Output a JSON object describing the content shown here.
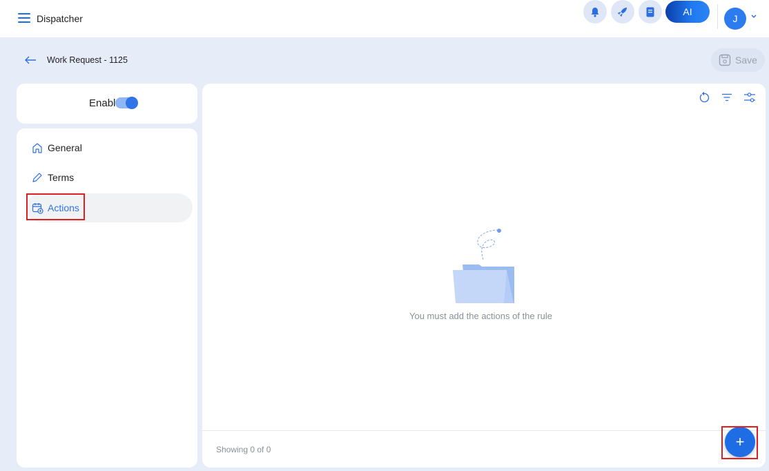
{
  "app": {
    "title": "Dispatcher"
  },
  "header": {
    "ai_label": "AI",
    "avatar_initial": "J",
    "icons": [
      "bell-icon",
      "rocket-icon",
      "document-icon"
    ]
  },
  "page": {
    "title": "Work Request - 1125",
    "save_label": "Save"
  },
  "status": {
    "enabled_label": "Enabled",
    "enabled": true
  },
  "sidebar": {
    "items": [
      {
        "label": "General",
        "icon": "home-icon",
        "active": false
      },
      {
        "label": "Terms",
        "icon": "pencil-icon",
        "active": false
      },
      {
        "label": "Actions",
        "icon": "calendar-add-icon",
        "active": true
      }
    ]
  },
  "main": {
    "empty_message": "You must add the actions of the rule",
    "footer": "Showing 0 of 0",
    "toolbar_icons": [
      "refresh-icon",
      "filter-icon",
      "settings-sliders-icon"
    ],
    "add_label": "+"
  },
  "colors": {
    "accent": "#1f6de4",
    "highlight": "#e02020",
    "background": "#e6edf9"
  }
}
